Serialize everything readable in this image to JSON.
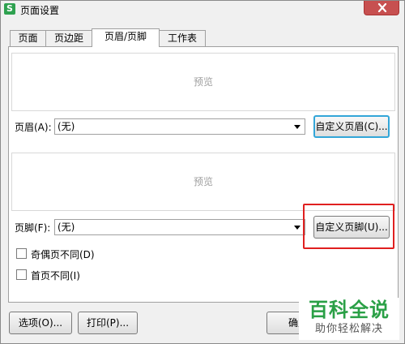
{
  "window": {
    "title": "页面设置",
    "app_icon_letter": "S",
    "app_icon_color": "#2ea14f",
    "close_icon": "close-icon"
  },
  "tabs": [
    {
      "label": "页面",
      "active": false
    },
    {
      "label": "页边距",
      "active": false
    },
    {
      "label": "页眉/页脚",
      "active": true
    },
    {
      "label": "工作表",
      "active": false
    }
  ],
  "header": {
    "preview_text": "预览",
    "label": "页眉(A):",
    "value": "(无)",
    "custom_button": "自定义页眉(C)..."
  },
  "footer": {
    "preview_text": "预览",
    "label": "页脚(F):",
    "value": "(无)",
    "custom_button": "自定义页脚(U)..."
  },
  "options": {
    "odd_even_label": "奇偶页不同(D)",
    "odd_even_checked": false,
    "first_page_label": "首页不同(I)",
    "first_page_checked": false
  },
  "buttons": {
    "options_label": "选项(O)...",
    "print_label": "打印(P)...",
    "ok_label": "确定"
  },
  "watermark": {
    "title": "百科全说",
    "subtitle": "助你轻松解决",
    "color": "#2aa046"
  },
  "annotation": {
    "highlight_color": "#e02020"
  }
}
